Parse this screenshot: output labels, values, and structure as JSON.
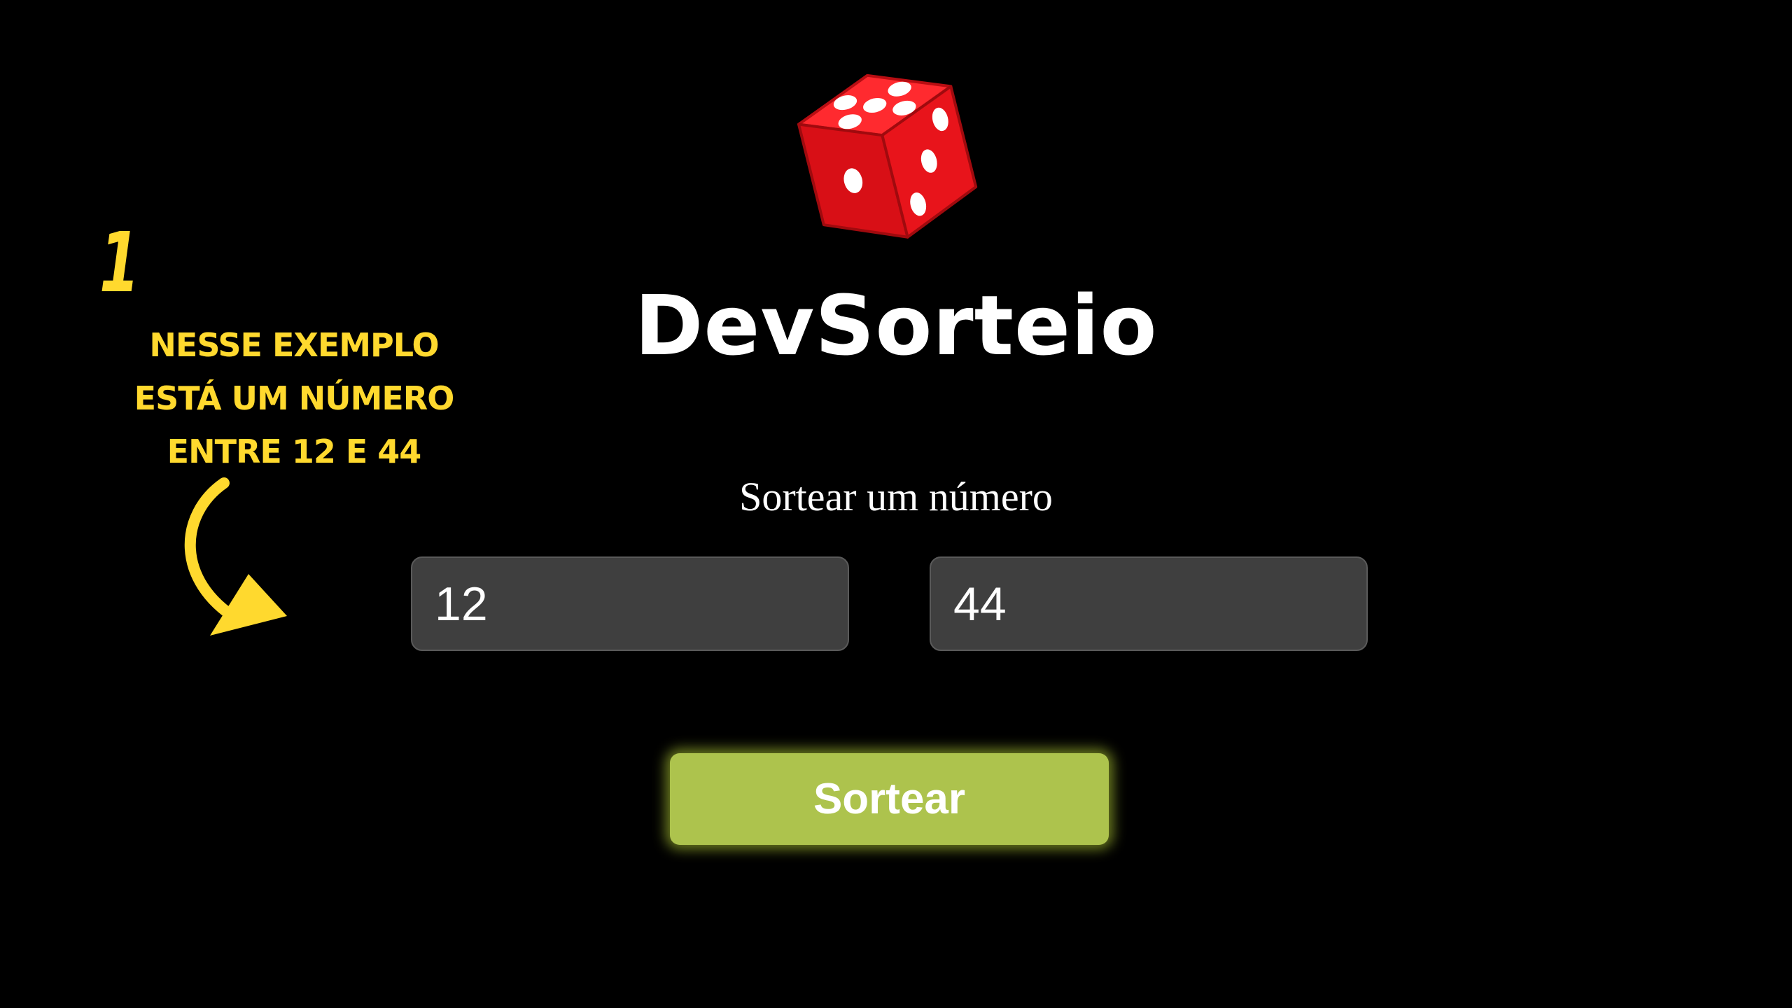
{
  "app": {
    "title": "DevSorteio",
    "subtitle": "Sortear um número",
    "min_value": "12",
    "max_value": "44",
    "button_label": "Sortear"
  },
  "annotation": {
    "step_number": "1",
    "text": "Nesse exemplo está um número entre 12 e 44"
  },
  "colors": {
    "background": "#000000",
    "dice": "#e0141b",
    "input_bg": "#3f3f3f",
    "button": "#adc34d",
    "annotation": "#ffd92e"
  },
  "icons": {
    "dice": "red-dice-icon",
    "arrow": "curved-arrow-icon"
  }
}
